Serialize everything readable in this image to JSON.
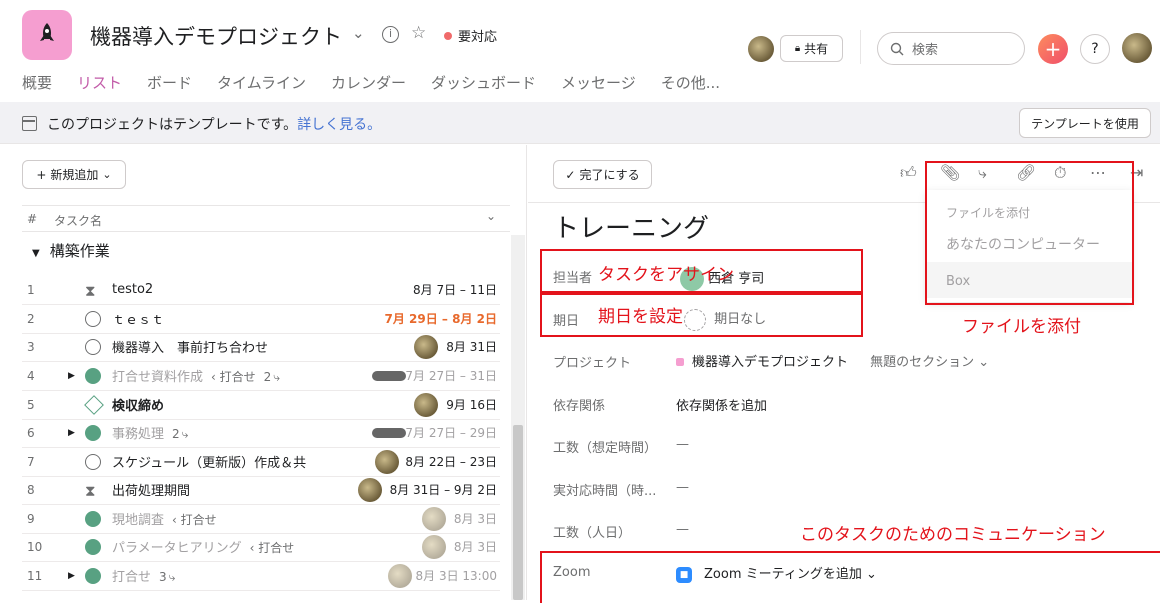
{
  "header": {
    "project_title": "機器導入デモプロジェクト",
    "status": "要対応",
    "share_label": "共有",
    "search_placeholder": "検索",
    "help_label": "?",
    "plus_label": "+",
    "tabs": [
      "概要",
      "リスト",
      "ボード",
      "タイムライン",
      "カレンダー",
      "ダッシュボード",
      "メッセージ",
      "その他..."
    ],
    "active_tab": "リスト"
  },
  "banner": {
    "text": "このプロジェクトはテンプレートです。",
    "link": "詳しく見る。",
    "button": "テンプレートを使用"
  },
  "list": {
    "add_button": "新規追加",
    "col_num": "#",
    "col_name": "タスク名",
    "section_name": "構築作業",
    "rows": [
      {
        "num": "1",
        "name": "testo2",
        "date": "8月 7日 – 11日"
      },
      {
        "num": "2",
        "name": "ｔｅｓｔ",
        "date": "7月 29日 – 8月 2日"
      },
      {
        "num": "3",
        "name": "機器導入　事前打ち合わせ",
        "date": "8月 31日"
      },
      {
        "num": "4",
        "name": "打合せ資料作成",
        "sub": "‹ 打合せ",
        "subcount": "2",
        "date": "7月 27日 – 31日"
      },
      {
        "num": "5",
        "name": "検収締め",
        "date": "9月 16日"
      },
      {
        "num": "6",
        "name": "事務処理",
        "subcount": "2",
        "date": "7月 27日 – 29日"
      },
      {
        "num": "7",
        "name": "スケジュール（更新版）作成＆共",
        "date": "8月 22日 – 23日"
      },
      {
        "num": "8",
        "name": "出荷処理期間",
        "date": "8月 31日 – 9月 2日"
      },
      {
        "num": "9",
        "name": "現地調査",
        "sub": "‹ 打合せ",
        "date": "8月 3日"
      },
      {
        "num": "10",
        "name": "パラメータヒアリング",
        "sub": "‹ 打合せ",
        "date": "8月 3日"
      },
      {
        "num": "11",
        "name": "打合せ",
        "subcount": "3",
        "date": "8月 3日 13:00"
      }
    ]
  },
  "detail": {
    "complete_button": "完了にする",
    "task_title": "トレーニング",
    "fields": [
      {
        "label": "担当者",
        "value": "西倉 亨司"
      },
      {
        "label": "期日",
        "value": "期日なし"
      },
      {
        "label": "プロジェクト",
        "value": "機器導入デモプロジェクト",
        "section": "無題のセクション"
      },
      {
        "label": "依存関係",
        "value": "依存関係を追加"
      },
      {
        "label": "工数（想定時間）",
        "value": "—"
      },
      {
        "label": "実対応時間（時...",
        "value": "—"
      },
      {
        "label": "工数（人日）",
        "value": "—"
      },
      {
        "label": "Zoom",
        "value": "Zoom ミーティングを追加"
      }
    ]
  },
  "attach_menu": {
    "header": "ファイルを添付",
    "items": [
      "あなたのコンピューター",
      "Box"
    ]
  },
  "annotations": {
    "assign": "タスクをアサイン",
    "due": "期日を設定",
    "attach": "ファイルを添付",
    "comm": "このタスクのためのコミュニケーション"
  },
  "colors": {
    "accent": "#c25ba8",
    "annotation": "#e3131b",
    "complete_green": "#58a182",
    "late": "#e8692c"
  }
}
